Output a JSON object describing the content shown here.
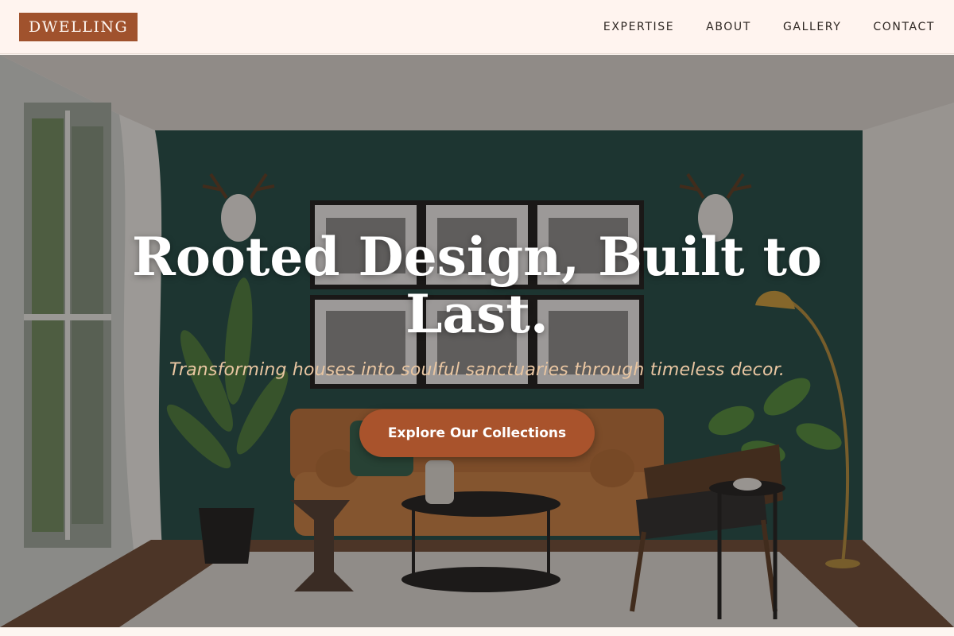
{
  "brand": {
    "logo": "DWELLING"
  },
  "nav": [
    {
      "label": "EXPERTISE"
    },
    {
      "label": "ABOUT"
    },
    {
      "label": "GALLERY"
    },
    {
      "label": "CONTACT"
    }
  ],
  "hero": {
    "title": "Rooted Design, Built to Last.",
    "subtitle": "Transforming houses into soulful sanctuaries through timeless decor.",
    "cta_label": "Explore Our Collections",
    "image_subject": "living room with green accent wall, leather sofa, gallery wall of framed prints, deer head mounts, plants and floor lamp"
  },
  "colors": {
    "header_bg": "#fff4ef",
    "brand_accent": "#a0522d",
    "cta_bg": "#a9532c",
    "subtitle_text": "#e9c6a2",
    "wall_green": "#1f4a44"
  }
}
